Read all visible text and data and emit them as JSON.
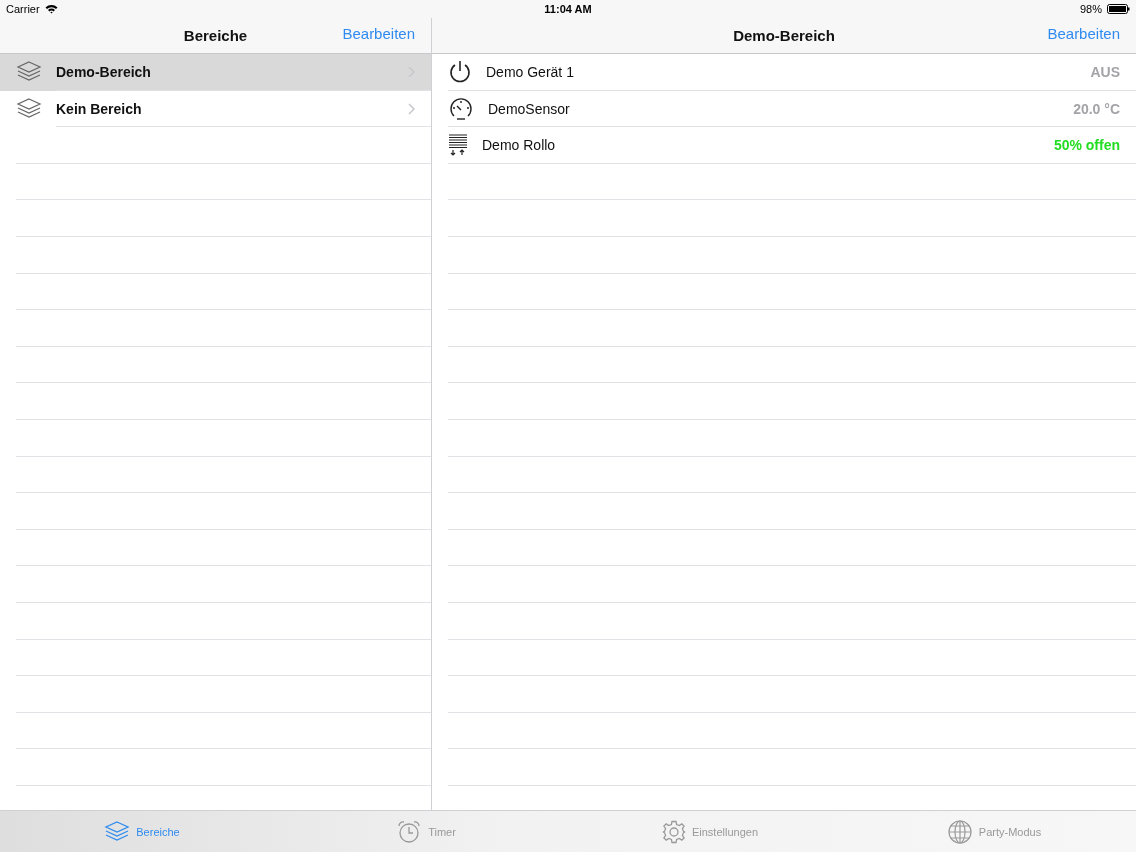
{
  "status_bar": {
    "carrier": "Carrier",
    "time": "11:04 AM",
    "battery": "98%"
  },
  "master": {
    "title": "Bereiche",
    "edit": "Bearbeiten",
    "items": [
      {
        "label": "Demo-Bereich",
        "selected": true
      },
      {
        "label": "Kein Bereich",
        "selected": false
      }
    ]
  },
  "detail": {
    "title": "Demo-Bereich",
    "edit": "Bearbeiten",
    "devices": [
      {
        "kind": "switch",
        "name": "Demo Gerät 1",
        "value": "AUS",
        "color": "#a3a3a8"
      },
      {
        "kind": "sensor",
        "name": "DemoSensor",
        "value": "20.0 °C",
        "color": "#a3a3a8"
      },
      {
        "kind": "shutter",
        "name": "Demo Rollo",
        "value": "50% offen",
        "color": "#22dd22"
      }
    ]
  },
  "tab_bar": [
    {
      "kind": "areas",
      "label": "Bereiche",
      "selected": true
    },
    {
      "kind": "timer",
      "label": "Timer",
      "selected": false
    },
    {
      "kind": "settings",
      "label": "Einstellungen",
      "selected": false
    },
    {
      "kind": "party",
      "label": "Party-Modus",
      "selected": false
    }
  ]
}
